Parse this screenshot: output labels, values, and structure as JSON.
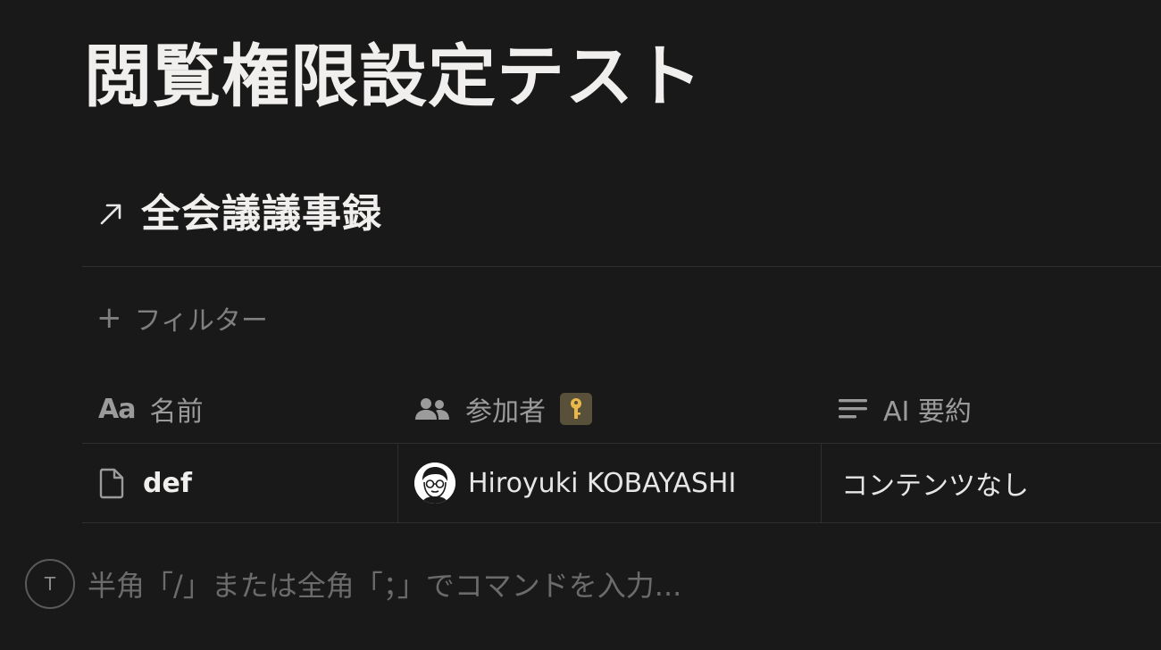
{
  "page": {
    "title": "閲覧権限設定テスト"
  },
  "database": {
    "title": "全会議議事録",
    "link_icon": "arrow-up-right-icon"
  },
  "filter": {
    "icon": "plus-icon",
    "label": "フィルター"
  },
  "table": {
    "columns": [
      {
        "icon": "text-type-icon",
        "icon_text": "Aa",
        "label": "名前"
      },
      {
        "icon": "people-icon",
        "label": "参加者",
        "badge_icon": "key-icon"
      },
      {
        "icon": "text-lines-icon",
        "label": "AI 要約"
      }
    ],
    "rows": [
      {
        "name_icon": "page-icon",
        "name": "def",
        "participant": "Hiroyuki KOBAYASHI",
        "participant_avatar": "avatar-illustration",
        "ai_summary": "コンテンツなし"
      }
    ]
  },
  "composer": {
    "avatar_initial": "T",
    "placeholder": "半角「/」または全角「；」でコマンドを入力..."
  },
  "colors": {
    "background": "#191919",
    "title": "#f0efed",
    "muted": "#9b9b9b",
    "divider": "#2f2f2f",
    "key_badge": "#59503a",
    "key_icon": "#e9b84a"
  }
}
